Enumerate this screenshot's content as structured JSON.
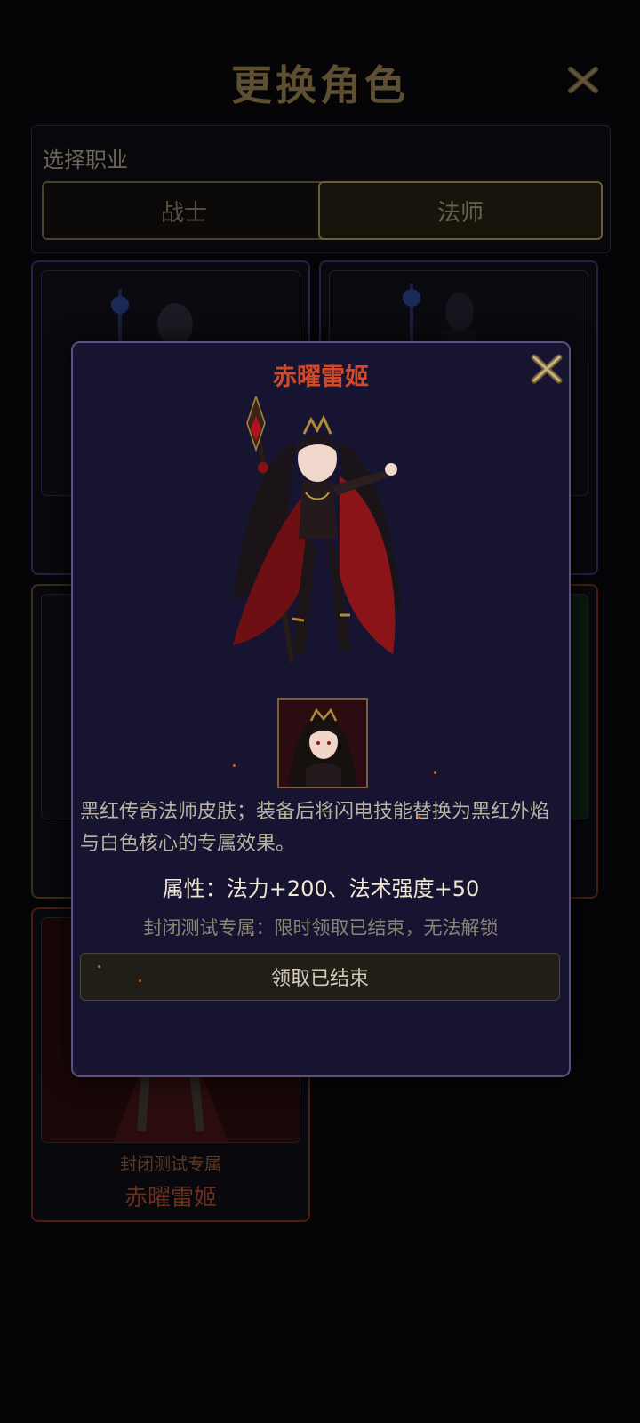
{
  "page": {
    "title": "更换角色",
    "job_select": {
      "label": "选择职业",
      "options": [
        "战士",
        "法师"
      ],
      "selected": "法师"
    },
    "cards": [
      {
        "variant": "blue"
      },
      {
        "variant": "blue"
      },
      {
        "variant": "gold"
      },
      {
        "variant": "red"
      },
      {
        "variant": "red",
        "tag": "封闭测试专属",
        "name": "赤曜雷姬"
      }
    ]
  },
  "modal": {
    "title": "赤曜雷姬",
    "description": "黑红传奇法师皮肤；装备后将闪电技能替换为黑红外焰与白色核心的专属效果。",
    "attributes": "属性：法力+200、法术强度+50",
    "note": "封闭测试专属：限时领取已结束，无法解锁",
    "claim_button": "领取已结束"
  },
  "colors": {
    "modal_bg": "#161430",
    "modal_border": "#5a4f7e",
    "title_red": "#d2492a",
    "gold": "#6b5d38"
  },
  "icons": [
    "close-icon",
    "character-portrait",
    "skin-thumbnail"
  ]
}
